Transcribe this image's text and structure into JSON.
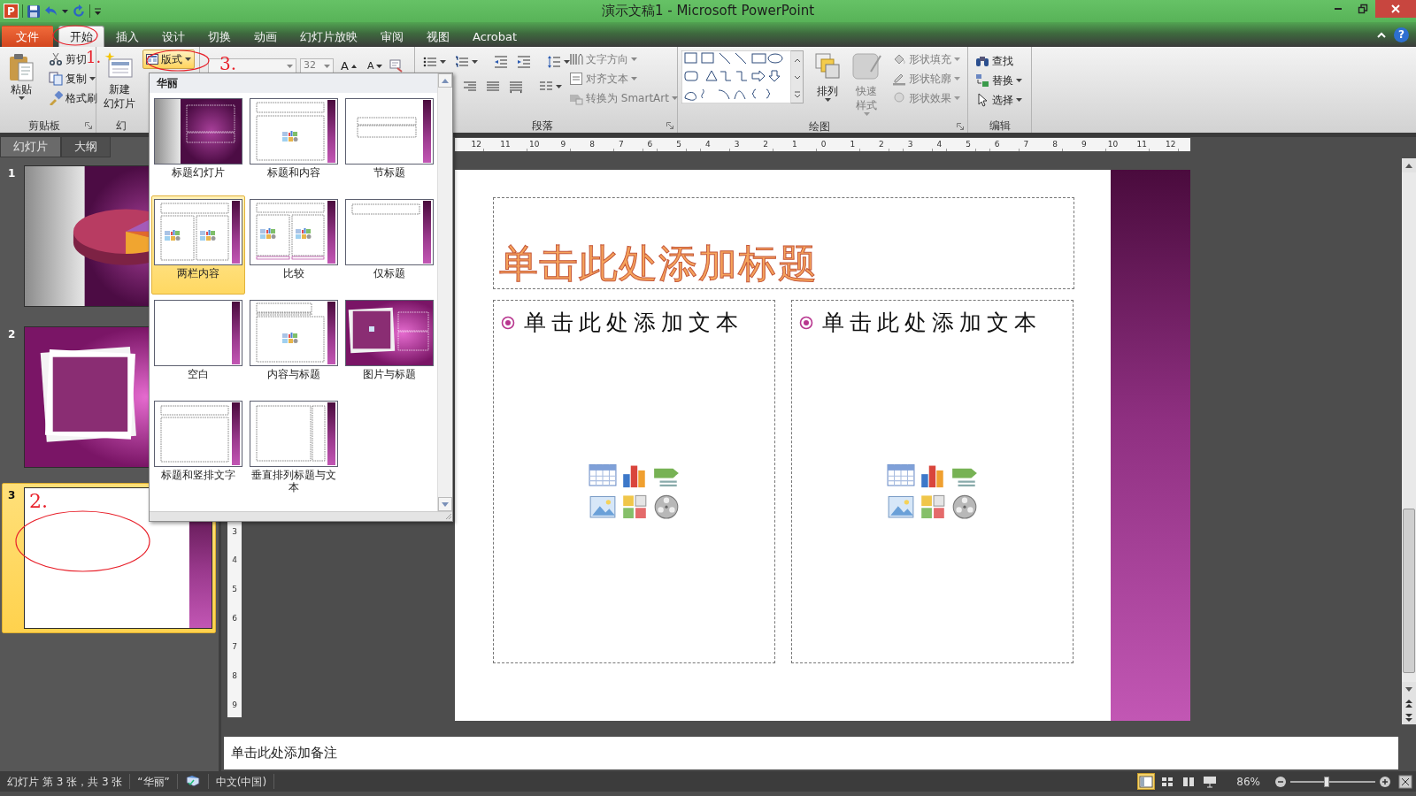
{
  "window": {
    "title": "演示文稿1 - Microsoft PowerPoint",
    "app_logo": "P"
  },
  "ribbon_tabs": [
    {
      "label": "文件",
      "kind": "file",
      "selected": false
    },
    {
      "label": "开始",
      "kind": "tab",
      "selected": true
    },
    {
      "label": "插入",
      "kind": "tab",
      "selected": false
    },
    {
      "label": "设计",
      "kind": "tab",
      "selected": false
    },
    {
      "label": "切换",
      "kind": "tab",
      "selected": false
    },
    {
      "label": "动画",
      "kind": "tab",
      "selected": false
    },
    {
      "label": "幻灯片放映",
      "kind": "tab",
      "selected": false
    },
    {
      "label": "审阅",
      "kind": "tab",
      "selected": false
    },
    {
      "label": "视图",
      "kind": "tab",
      "selected": false
    },
    {
      "label": "Acrobat",
      "kind": "tab",
      "selected": false
    }
  ],
  "help": "?",
  "ribbon": {
    "clipboard": {
      "paste": "粘贴",
      "cut": "剪切",
      "copy": "复制",
      "format_painter": "格式刷",
      "label": "剪贴板"
    },
    "slides": {
      "new_slide": [
        "新建",
        "幻灯片"
      ],
      "layout": {
        "label": "版式",
        "expanded": true
      },
      "label": "幻"
    },
    "font": {
      "size": {
        "value": "32",
        "disabled": true
      },
      "grow": "A",
      "shrink": "A"
    },
    "paragraph": {
      "commands": [
        {
          "label": "文字方向",
          "kind": "text_direction",
          "disabled": true
        },
        {
          "label": "对齐文本",
          "kind": "align_text",
          "disabled": true
        },
        {
          "label": "转换为 SmartArt",
          "kind": "smartart",
          "disabled": true
        }
      ],
      "label": "段落"
    },
    "drawing": {
      "arrange": "排列",
      "quick_styles": {
        "label": "快速样式",
        "disabled": true
      },
      "commands": [
        {
          "label": "形状填充",
          "kind": "fill",
          "disabled": true
        },
        {
          "label": "形状轮廓",
          "kind": "outline",
          "disabled": true
        },
        {
          "label": "形状效果",
          "kind": "effects",
          "disabled": true
        }
      ],
      "label": "绘图"
    },
    "editing": {
      "commands": [
        {
          "label": "查找",
          "kind": "find"
        },
        {
          "label": "替换",
          "kind": "replace"
        },
        {
          "label": "选择",
          "kind": "select"
        }
      ],
      "label": "编辑"
    }
  },
  "slides_panel": {
    "tabs": [
      {
        "label": "幻灯片",
        "selected": true
      },
      {
        "label": "大纲",
        "selected": false
      }
    ],
    "slides": [
      {
        "number": "1",
        "kind": "chart",
        "selected": false
      },
      {
        "number": "2",
        "kind": "picture_frame",
        "selected": false
      },
      {
        "number": "3",
        "kind": "blank",
        "selected": true
      }
    ]
  },
  "layout_gallery": {
    "theme": "华丽",
    "layouts": [
      {
        "label": "标题幻灯片",
        "kind": "title_slide",
        "selected": false
      },
      {
        "label": "标题和内容",
        "kind": "title_content",
        "selected": false
      },
      {
        "label": "节标题",
        "kind": "section",
        "selected": false
      },
      {
        "label": "两栏内容",
        "kind": "two_content",
        "selected": true
      },
      {
        "label": "比较",
        "kind": "comparison",
        "selected": false
      },
      {
        "label": "仅标题",
        "kind": "title_only",
        "selected": false
      },
      {
        "label": "空白",
        "kind": "blank",
        "selected": false
      },
      {
        "label": "内容与标题",
        "kind": "content_caption",
        "selected": false
      },
      {
        "label": "图片与标题",
        "kind": "picture_caption",
        "selected": false
      },
      {
        "label": "标题和竖排文字",
        "kind": "vertical_text",
        "selected": false
      },
      {
        "label": "垂直排列标题与文本",
        "kind": "vertical_title",
        "selected": false
      }
    ]
  },
  "ruler": {
    "horizontal": [
      "12",
      "11",
      "10",
      "9",
      "8",
      "7",
      "6",
      "5",
      "4",
      "3",
      "2",
      "1",
      "0",
      "1",
      "2",
      "3",
      "4",
      "5",
      "6",
      "7",
      "8",
      "9",
      "10",
      "11",
      "12"
    ],
    "vertical": [
      "3",
      "4",
      "5",
      "6",
      "7",
      "8",
      "9"
    ]
  },
  "slide": {
    "title_placeholder": "单击此处添加标题",
    "content_placeholders": [
      "单击此处添加文本",
      "单击此处添加文本"
    ]
  },
  "notes": {
    "placeholder": "单击此处添加备注"
  },
  "status_bar": {
    "slide_info": "幻灯片 第 3 张，共 3 张",
    "theme": "“华丽”",
    "language": "中文(中国)",
    "views": [
      {
        "kind": "normal",
        "selected": true
      },
      {
        "kind": "sorter",
        "selected": false
      },
      {
        "kind": "reading",
        "selected": false
      },
      {
        "kind": "slideshow",
        "selected": false
      }
    ],
    "zoom": "86%",
    "zoom_slider": {
      "level": 0.43
    }
  },
  "annotations": {
    "tab_mark": "1.",
    "slide_mark": "2.",
    "layout_mark": "3."
  }
}
